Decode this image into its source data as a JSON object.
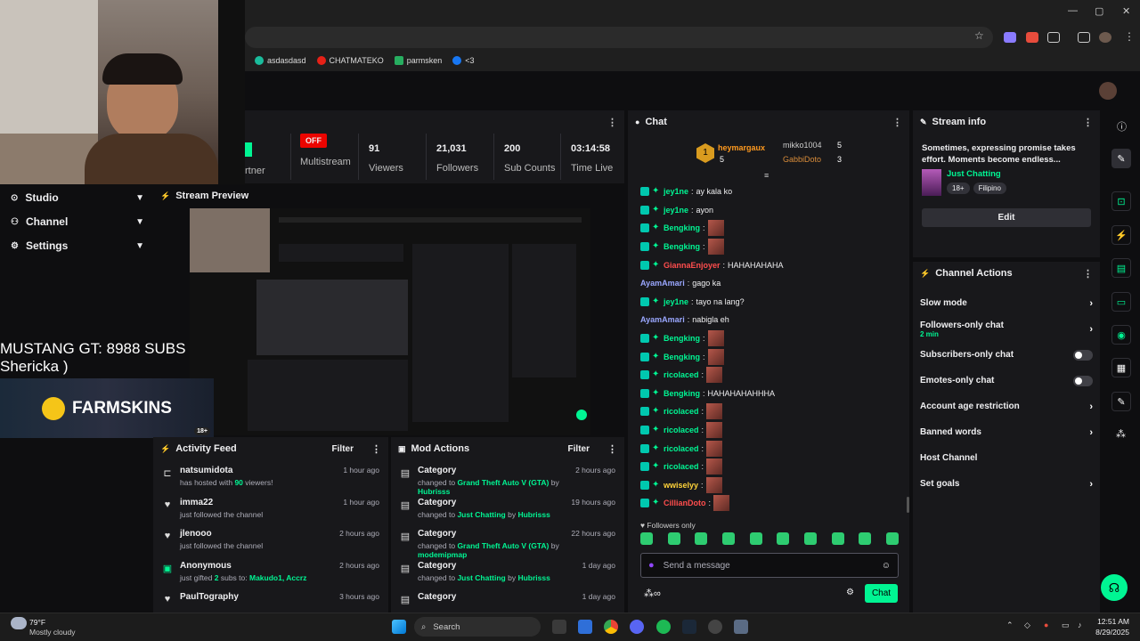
{
  "bookmarks": [
    {
      "label": "asdasdasd",
      "color": "#1abc9c"
    },
    {
      "label": "CHATMATEKO",
      "color": "#e62117"
    },
    {
      "label": "parmsken",
      "color": "#27ae60"
    },
    {
      "label": "<3",
      "color": "#1877f2"
    }
  ],
  "window_controls": {
    "minimize": "—",
    "maximize": "▢",
    "close": "✕"
  },
  "stats": [
    {
      "value": "OFF",
      "label": "Multistream"
    },
    {
      "value": "91",
      "label": "Viewers"
    },
    {
      "value": "21,031",
      "label": "Followers"
    },
    {
      "value": "200",
      "label": "Sub Counts"
    },
    {
      "value": "03:14:58",
      "label": "Time Live"
    }
  ],
  "stats_partial_label": "rtner",
  "sidebar": {
    "items": [
      {
        "label": "Studio",
        "icon": "studio-icon"
      },
      {
        "label": "Channel",
        "icon": "channel-icon"
      },
      {
        "label": "Settings",
        "icon": "gear-icon"
      }
    ]
  },
  "overlay": {
    "line1": "MUSTANG GT: 8988 SUBS",
    "line2": "Shericka )",
    "sponsor": "FARMSKINS",
    "age_badge": "18+"
  },
  "preview": {
    "title": "Stream Preview"
  },
  "activity": {
    "title": "Activity Feed",
    "filter": "Filter",
    "items": [
      {
        "user": "natsumidota",
        "pre": "has hosted with ",
        "bold": "90",
        "post": " viewers!",
        "time": "1 hour ago",
        "icon": "host-icon"
      },
      {
        "user": "imma22",
        "pre": "just followed the channel",
        "bold": "",
        "post": "",
        "time": "1 hour ago",
        "icon": "heart-icon"
      },
      {
        "user": "jlenooo",
        "pre": "just followed the channel",
        "bold": "",
        "post": "",
        "time": "2 hours ago",
        "icon": "heart-icon"
      },
      {
        "user": "Anonymous",
        "pre": "just gifted ",
        "bold": "2",
        "post": " subs to: ",
        "bold2": "Makudo1, Accrz",
        "time": "2 hours ago",
        "icon": "gift-icon"
      },
      {
        "user": "PaulTography",
        "pre": "",
        "bold": "",
        "post": "",
        "time": "3 hours ago",
        "icon": "heart-icon"
      }
    ]
  },
  "mod": {
    "title": "Mod Actions",
    "filter": "Filter",
    "items": [
      {
        "title": "Category",
        "pre": "changed to ",
        "game": "Grand Theft Auto V (GTA)",
        "by": " by ",
        "mod": "Hubrisss",
        "time": "2 hours ago"
      },
      {
        "title": "Category",
        "pre": "changed to ",
        "game": "Just Chatting",
        "by": " by ",
        "mod": "Hubrisss",
        "time": "19 hours ago"
      },
      {
        "title": "Category",
        "pre": "changed to ",
        "game": "Grand Theft Auto V (GTA)",
        "by": " by ",
        "mod": "modemipmap",
        "time": "22 hours ago"
      },
      {
        "title": "Category",
        "pre": "changed to ",
        "game": "Just Chatting",
        "by": " by ",
        "mod": "Hubrisss",
        "time": "1 day ago"
      },
      {
        "title": "Category",
        "pre": "",
        "game": "",
        "by": "",
        "mod": "",
        "time": "1 day ago"
      }
    ]
  },
  "chat": {
    "title": "Chat",
    "top": [
      {
        "rank": "1",
        "user": "heymargaux",
        "count": "5",
        "color": "#ff9a1f"
      },
      {
        "rank": "",
        "user": "mikko1004",
        "count": "5",
        "color": "#cccccc"
      },
      {
        "rank": "",
        "user": "GabbiDoto",
        "count": "3",
        "color": "#d98c3a"
      }
    ],
    "messages": [
      {
        "user": "jey1ne",
        "text": "ay kala ko",
        "color": "#00f593",
        "emote": false
      },
      {
        "user": "jey1ne",
        "text": "ayon",
        "color": "#00f593",
        "emote": false
      },
      {
        "user": "Bengking",
        "text": "",
        "color": "#00f593",
        "emote": true
      },
      {
        "user": "Bengking",
        "text": "",
        "color": "#00f593",
        "emote": true
      },
      {
        "user": "GiannaEnjoyer",
        "text": "HAHAHAHAHA",
        "color": "#ff4d4d",
        "emote": false
      },
      {
        "user": "AyamAmari",
        "text": "gago ka",
        "color": "#9aa7ff",
        "emote": false
      },
      {
        "user": "jey1ne",
        "text": "tayo na lang?",
        "color": "#00f593",
        "emote": false
      },
      {
        "user": "AyamAmari",
        "text": "nabigla eh",
        "color": "#9aa7ff",
        "emote": false
      },
      {
        "user": "Bengking",
        "text": "",
        "color": "#00f593",
        "emote": true
      },
      {
        "user": "Bengking",
        "text": "",
        "color": "#00f593",
        "emote": true
      },
      {
        "user": "ricolaced",
        "text": "",
        "color": "#00f593",
        "emote": true
      },
      {
        "user": "Bengking",
        "text": "HAHAHAHAHHHA",
        "color": "#00f593",
        "emote": false
      },
      {
        "user": "ricolaced",
        "text": "",
        "color": "#00f593",
        "emote": true
      },
      {
        "user": "ricolaced",
        "text": "",
        "color": "#00f593",
        "emote": true
      },
      {
        "user": "ricolaced",
        "text": "",
        "color": "#00f593",
        "emote": true
      },
      {
        "user": "ricolaced",
        "text": "",
        "color": "#00f593",
        "emote": true
      },
      {
        "user": "wwiselyy",
        "text": "",
        "color": "#ffd33a",
        "emote": true
      },
      {
        "user": "CillianDoto",
        "text": "",
        "color": "#ff4d4d",
        "emote": true
      }
    ],
    "followers_only": "Followers only",
    "placeholder": "Send a message",
    "send": "Chat"
  },
  "stream_info": {
    "title": "Stream info",
    "description": "Sometimes, expressing promise takes effort. Moments become endless...",
    "category": "Just Chatting",
    "tags": [
      "18+",
      "Filipino"
    ],
    "edit": "Edit"
  },
  "channel_actions": {
    "title": "Channel Actions",
    "items": [
      {
        "label": "Slow mode",
        "sub": "",
        "control": "chevron"
      },
      {
        "label": "Followers-only chat",
        "sub": "2 min",
        "control": "chevron"
      },
      {
        "label": "Subscribers-only chat",
        "sub": "",
        "control": "toggle"
      },
      {
        "label": "Emotes-only chat",
        "sub": "",
        "control": "toggle"
      },
      {
        "label": "Account age restriction",
        "sub": "",
        "control": "chevron"
      },
      {
        "label": "Banned words",
        "sub": "",
        "control": "chevron"
      },
      {
        "label": "Host Channel",
        "sub": "",
        "control": "none"
      },
      {
        "label": "Set goals",
        "sub": "",
        "control": "chevron"
      }
    ]
  },
  "taskbar": {
    "weather_temp": "79°F",
    "weather_desc": "Mostly cloudy",
    "search": "Search",
    "time": "12:51 AM",
    "date": "8/29/2025"
  },
  "colors": {
    "accent": "#00f593",
    "bg": "#0e0e10",
    "panel": "#18181b",
    "offline": "#eb0400"
  }
}
